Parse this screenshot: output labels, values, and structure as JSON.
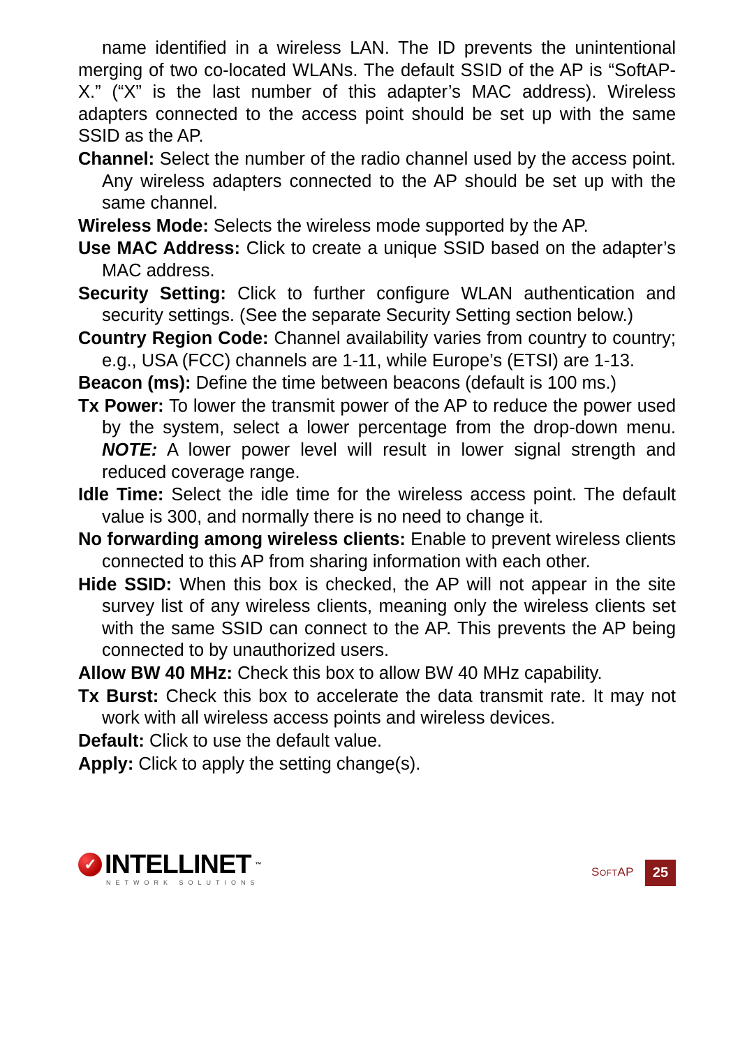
{
  "entries": {
    "ssid_cont": "name identified in a wireless LAN. The ID prevents the unintentional merging of two co-located WLANs. The default SSID of the AP is “SoftAP-X.” (“X” is the last number of this adapter’s MAC address). Wireless adapters connected to the access point should be set up with the same SSID as the AP.",
    "channel_label": "Channel:",
    "channel_text": " Select the number of the radio channel used by the access point. Any wireless adapters connected to the AP should be set up with the same channel.",
    "wireless_mode_label": "Wireless Mode:",
    "wireless_mode_text": " Selects the wireless mode supported by the AP.",
    "use_mac_label": "Use MAC Address:",
    "use_mac_text": " Click to create a unique SSID based on the adapter’s MAC address.",
    "security_label": "Security Setting:",
    "security_text": " Click to further configure WLAN authentication and security settings. (See the separate Security Setting section below.)",
    "country_label": "Country Region Code:",
    "country_text": " Channel availability varies from country to country; e.g., USA (FCC) channels are 1-11, while Europe’s (ETSI) are 1-13.",
    "beacon_label": "Beacon (ms):",
    "beacon_text": " Define the time between beacons (default is 100 ms.)",
    "txpower_label": "Tx Power:",
    "txpower_text_a": " To lower the transmit power of the AP to reduce the power used by the system, select a lower percentage from the drop-down menu. ",
    "txpower_note": "NOTE:",
    "txpower_text_b": " A lower power level will result in lower signal strength and reduced coverage range.",
    "idle_label": "Idle Time:",
    "idle_text": " Select the idle time for the wireless access point. The default value is 300, and normally there is no need to change it.",
    "nofwd_label": "No forwarding among wireless clients:",
    "nofwd_text": " Enable to prevent wireless clients connected to this AP from sharing information with each other.",
    "hide_label": "Hide SSID:",
    "hide_text": " When this box is checked, the AP will not appear in the site survey list of any wireless clients, meaning only the wireless clients set with the same SSID can connect to the AP. This prevents the AP being connected to by unauthorized users.",
    "allow_label": "Allow BW 40 MHz:",
    "allow_text": " Check this box to allow BW 40 MHz capability.",
    "txburst_label": "Tx Burst:",
    "txburst_text": " Check this box to accelerate the data transmit rate. It may not work with all wireless access points and wireless devices.",
    "default_label": "Default:",
    "default_text": " Click to use the default value.",
    "apply_label": "Apply:",
    "apply_text": " Click to apply the setting change(s)."
  },
  "footer": {
    "brand": "INTELLINET",
    "brand_sub": "NETWORK SOLUTIONS",
    "section": "SoftAP",
    "page": "25",
    "tm": "™"
  }
}
